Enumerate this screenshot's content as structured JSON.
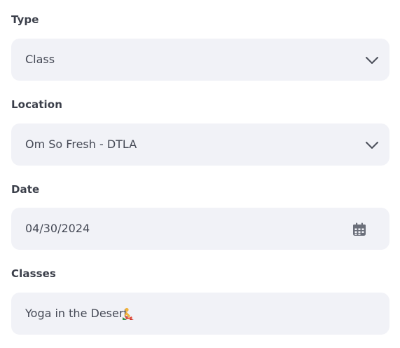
{
  "fields": {
    "type": {
      "label": "Type",
      "value": "Class",
      "icon": "chevron-down-icon"
    },
    "location": {
      "label": "Location",
      "value": "Om So Fresh - DTLA",
      "icon": "chevron-down-icon"
    },
    "date": {
      "label": "Date",
      "value": "04/30/2024",
      "icon": "calendar-icon"
    },
    "classes": {
      "label": "Classes",
      "value": "Yoga in the Desert",
      "icon": "yoga-emoji-icon"
    }
  },
  "colors": {
    "field_background": "#f1f2f7",
    "label_text": "#3b3f4a",
    "value_text": "#454955",
    "icon": "#6b6f7a"
  }
}
